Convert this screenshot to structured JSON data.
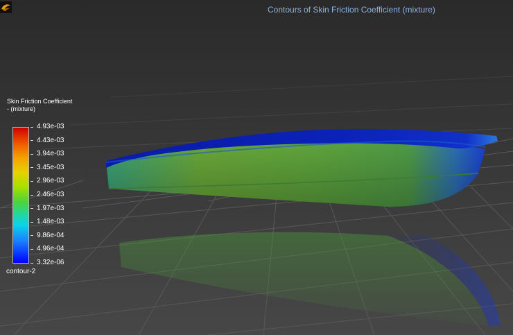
{
  "window": {
    "title": "Contours of Skin Friction Coefficient (mixture)"
  },
  "legend": {
    "title_line1": "Skin Friction Coefficient",
    "title_line2": "- (mixture)",
    "tick_labels": [
      "4.93e-03",
      "4.43e-03",
      "3.94e-03",
      "3.45e-03",
      "2.96e-03",
      "2.46e-03",
      "1.97e-03",
      "1.48e-03",
      "9.86e-04",
      "4.96e-04",
      "3.32e-06"
    ],
    "contour_name": "contour-2",
    "colormap": [
      "#d10000",
      "#f05a00",
      "#f5a000",
      "#e6d200",
      "#a6e000",
      "#4cd43a",
      "#1ed6a8",
      "#0ad4e8",
      "#1a7fff",
      "#0000ff"
    ]
  },
  "icons": {
    "app_logo": "fluent-logo-icon"
  },
  "colors": {
    "title_text": "#8ab4e8",
    "hull_deck": "#0a1fb0",
    "hull_side": "#4c9a3a",
    "floor_grid": "#5a5a5a"
  }
}
